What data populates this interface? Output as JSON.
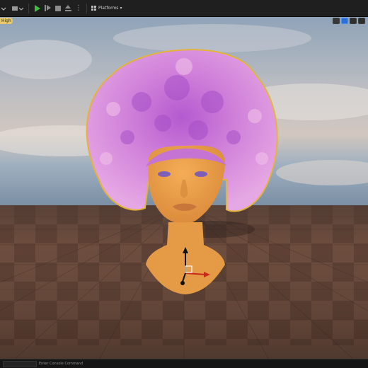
{
  "toolbar": {
    "platforms_label": "Platforms",
    "play_icon": "play-icon",
    "step_icon": "step-icon",
    "stop_icon": "stop-icon",
    "eject_icon": "eject-icon",
    "more_icon": "more-options-icon",
    "accent_play": "#3fbf3f"
  },
  "viewport": {
    "corner_tag": "High",
    "scene": {
      "sky_top": "#9fb2c5",
      "horizon": "#c9c6c4",
      "floor_a": "#6b4b3c",
      "floor_b": "#5a3d31",
      "hair_color": "#d88ad6",
      "skin_color": "#e9a04b",
      "selection_outline": "#e4b33a"
    },
    "tools": [
      "select-icon",
      "translate-icon",
      "rotate-icon",
      "scale-icon"
    ]
  },
  "statusbar": {
    "console_text": "Enter Console Command"
  }
}
